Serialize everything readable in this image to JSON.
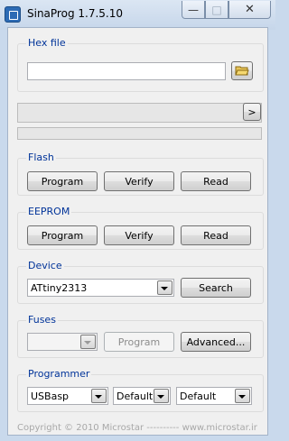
{
  "window": {
    "title": "SinaProg 1.7.5.10",
    "minimize": "—",
    "maximize": "□",
    "close": "✕"
  },
  "hexfile": {
    "legend": "Hex file",
    "value": ""
  },
  "progress": {
    "arrow": ">",
    "value": 0
  },
  "flash": {
    "legend": "Flash",
    "program": "Program",
    "verify": "Verify",
    "read": "Read"
  },
  "eeprom": {
    "legend": "EEPROM",
    "program": "Program",
    "verify": "Verify",
    "read": "Read"
  },
  "device": {
    "legend": "Device",
    "selected": "ATtiny2313",
    "search": "Search"
  },
  "fuses": {
    "legend": "Fuses",
    "selected": "",
    "program": "Program",
    "advanced": "Advanced..."
  },
  "programmer": {
    "legend": "Programmer",
    "programmer": "USBasp",
    "port": "Default",
    "speed": "Default"
  },
  "footer": "Copyright © 2010 Microstar   ----------   www.microstar.ir",
  "icons": {
    "app": "chip-icon",
    "folder": "folder-open-icon"
  }
}
